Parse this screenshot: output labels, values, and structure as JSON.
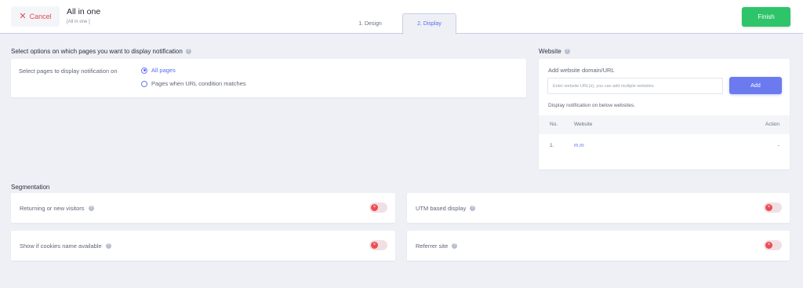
{
  "header": {
    "cancel_label": "Cancel",
    "title": "All in one",
    "subtitle": "[All in one ]",
    "tabs": [
      {
        "label": "1. Design",
        "active": false
      },
      {
        "label": "2. Display",
        "active": true
      }
    ],
    "finish_label": "Finish"
  },
  "pages_section": {
    "heading": "Select options on which pages you want to display notification",
    "label": "Select pages to display notification on",
    "options": [
      {
        "label": "All pages",
        "selected": true
      },
      {
        "label": "Pages when URL condition matches",
        "selected": false
      }
    ]
  },
  "website_section": {
    "heading": "Website",
    "add_label": "Add website domain/URL",
    "input_placeholder": "Enter website URL(s), you can add multiple websites",
    "input_value": "",
    "add_button": "Add",
    "note": "Display notification on below websites.",
    "columns": [
      "No.",
      "Website",
      "Action"
    ],
    "rows": [
      {
        "no": "1.",
        "website": "m.m",
        "action": "-"
      }
    ]
  },
  "segmentation": {
    "heading": "Segmentation",
    "items": [
      {
        "label": "Returning or new visitors",
        "enabled": false
      },
      {
        "label": "UTM based display",
        "enabled": false
      },
      {
        "label": "Show if cookies name available",
        "enabled": false
      },
      {
        "label": "Referrer site",
        "enabled": false
      }
    ]
  },
  "colors": {
    "accent": "#5a6cf0",
    "finish": "#2ec46a",
    "cancel": "#e5484d",
    "toggle_off": "#ee4b55"
  }
}
